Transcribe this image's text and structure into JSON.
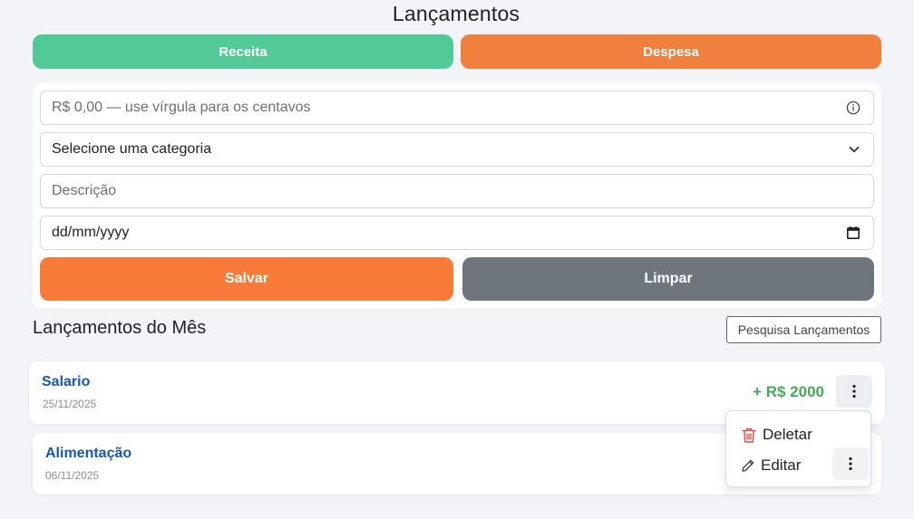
{
  "page": {
    "title": "Lançamentos"
  },
  "type_toggle": {
    "receita": "Receita",
    "despesa": "Despesa"
  },
  "form": {
    "valor_placeholder": "R$ 0,00 — use vírgula para os centavos",
    "categoria_value": "Selecione uma categoria",
    "descricao_placeholder": "Descrição",
    "data_placeholder": "dd/mm/yyyy",
    "save_label": "Salvar",
    "clear_label": "Limpar"
  },
  "list": {
    "title": "Lançamentos do Mês",
    "search_label": "Pesquisa Lançamentos",
    "entries": [
      {
        "category": "Salario",
        "date": "25/11/2025",
        "amount": "+ R$ 2000"
      },
      {
        "category": "Alimentação",
        "date": "06/11/2025"
      }
    ]
  },
  "menu": {
    "delete_label": "Deletar",
    "edit_label": "Editar"
  },
  "colors": {
    "receita": "#52c996",
    "despesa": "#f0803e",
    "salvar": "#f77a38",
    "limpar": "#6e757d",
    "income_amount": "#47a85a",
    "category_link": "#1858a8"
  },
  "icons": [
    "info-icon",
    "chevron-down-icon",
    "calendar-icon",
    "kebab-icon",
    "trash-icon",
    "pencil-icon"
  ]
}
